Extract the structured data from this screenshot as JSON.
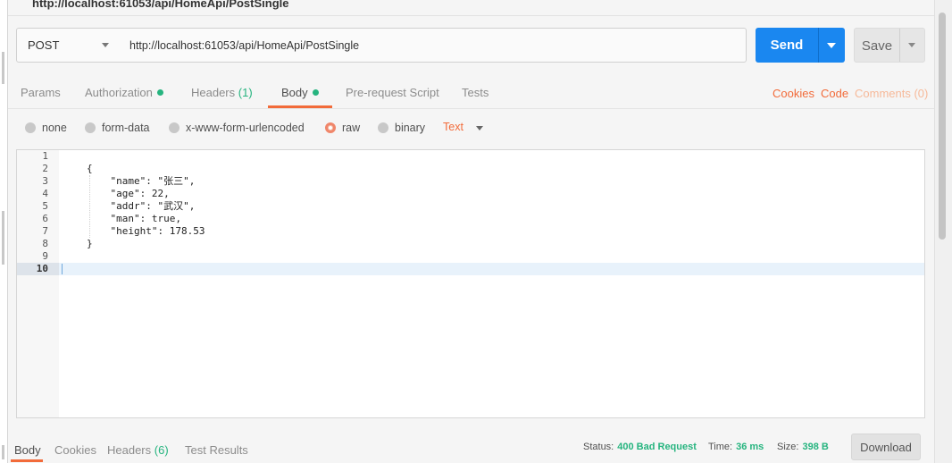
{
  "request": {
    "title": "http://localhost:61053/api/HomeApi/PostSingle",
    "method": "POST",
    "url": "http://localhost:61053/api/HomeApi/PostSingle",
    "send_label": "Send",
    "save_label": "Save"
  },
  "tabs": {
    "params": "Params",
    "authorization": "Authorization",
    "headers": "Headers",
    "headers_count": "(1)",
    "body": "Body",
    "prerequest": "Pre-request Script",
    "tests": "Tests",
    "active": "Body"
  },
  "links": {
    "cookies": "Cookies",
    "code": "Code",
    "comments": "Comments (0)"
  },
  "body_types": {
    "none": "none",
    "form_data": "form-data",
    "urlencoded": "x-www-form-urlencoded",
    "raw": "raw",
    "binary": "binary",
    "selected": "raw",
    "content_type": "Text"
  },
  "editor": {
    "line_numbers": [
      "1",
      "2",
      "3",
      "4",
      "5",
      "6",
      "7",
      "8",
      "9",
      "10"
    ],
    "active_line": "10",
    "code_lines": [
      "",
      "{",
      "    \"name\": \"张三\",",
      "    \"age\": 22,",
      "    \"addr\": \"武汉\",",
      "    \"man\": true,",
      "    \"height\": 178.53",
      "}",
      "",
      ""
    ]
  },
  "response": {
    "tabs": {
      "body": "Body",
      "cookies": "Cookies",
      "headers": "Headers",
      "headers_count": "(6)",
      "test_results": "Test Results"
    },
    "status_label": "Status:",
    "status_value": "400 Bad Request",
    "time_label": "Time:",
    "time_value": "36 ms",
    "size_label": "Size:",
    "size_value": "398 B",
    "download_label": "Download"
  },
  "colors": {
    "accent": "#f26b3a",
    "send_blue": "#1a87f0",
    "status_green": "#26b47f"
  }
}
